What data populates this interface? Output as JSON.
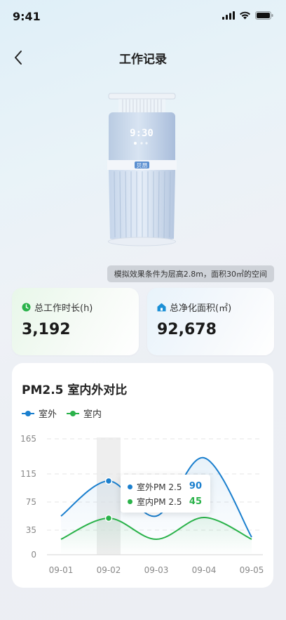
{
  "status": {
    "time": "9:41"
  },
  "nav": {
    "title": "工作记录"
  },
  "device": {
    "display_time": "9:30",
    "brand": "贝昂"
  },
  "banner": {
    "text": "模拟效果条件为层高2.8m，面积30㎡的空间"
  },
  "stats": [
    {
      "label": "总工作时长(h)",
      "value": "3,192",
      "icon": "clock-icon",
      "color": "#2ab24a"
    },
    {
      "label": "总净化面积(㎡)",
      "value": "92,678",
      "icon": "house-icon",
      "color": "#1a8fd6"
    }
  ],
  "chart_card": {
    "title": "PM2.5 室内外对比"
  },
  "colors": {
    "outdoor": "#1a7fce",
    "indoor": "#2ab24a"
  },
  "chart_data": {
    "type": "line",
    "title": "PM2.5 室内外对比",
    "categories": [
      "09-01",
      "09-02",
      "09-03",
      "09-04",
      "09-05"
    ],
    "y_ticks": [
      0,
      35,
      75,
      115,
      165
    ],
    "ylim": [
      0,
      165
    ],
    "grid": true,
    "legend": "top-left",
    "series": [
      {
        "name": "室外",
        "color": "#1a7fce",
        "values": [
          55,
          105,
          55,
          138,
          25
        ]
      },
      {
        "name": "室内",
        "color": "#2ab24a",
        "values": [
          22,
          52,
          22,
          53,
          22
        ]
      }
    ],
    "highlight": {
      "category": "09-02"
    }
  },
  "tooltip": {
    "rows": [
      {
        "label": "室外PM 2.5",
        "value": "90",
        "color": "#1a7fce"
      },
      {
        "label": "室内PM 2.5",
        "value": "45",
        "color": "#2ab24a"
      }
    ]
  }
}
